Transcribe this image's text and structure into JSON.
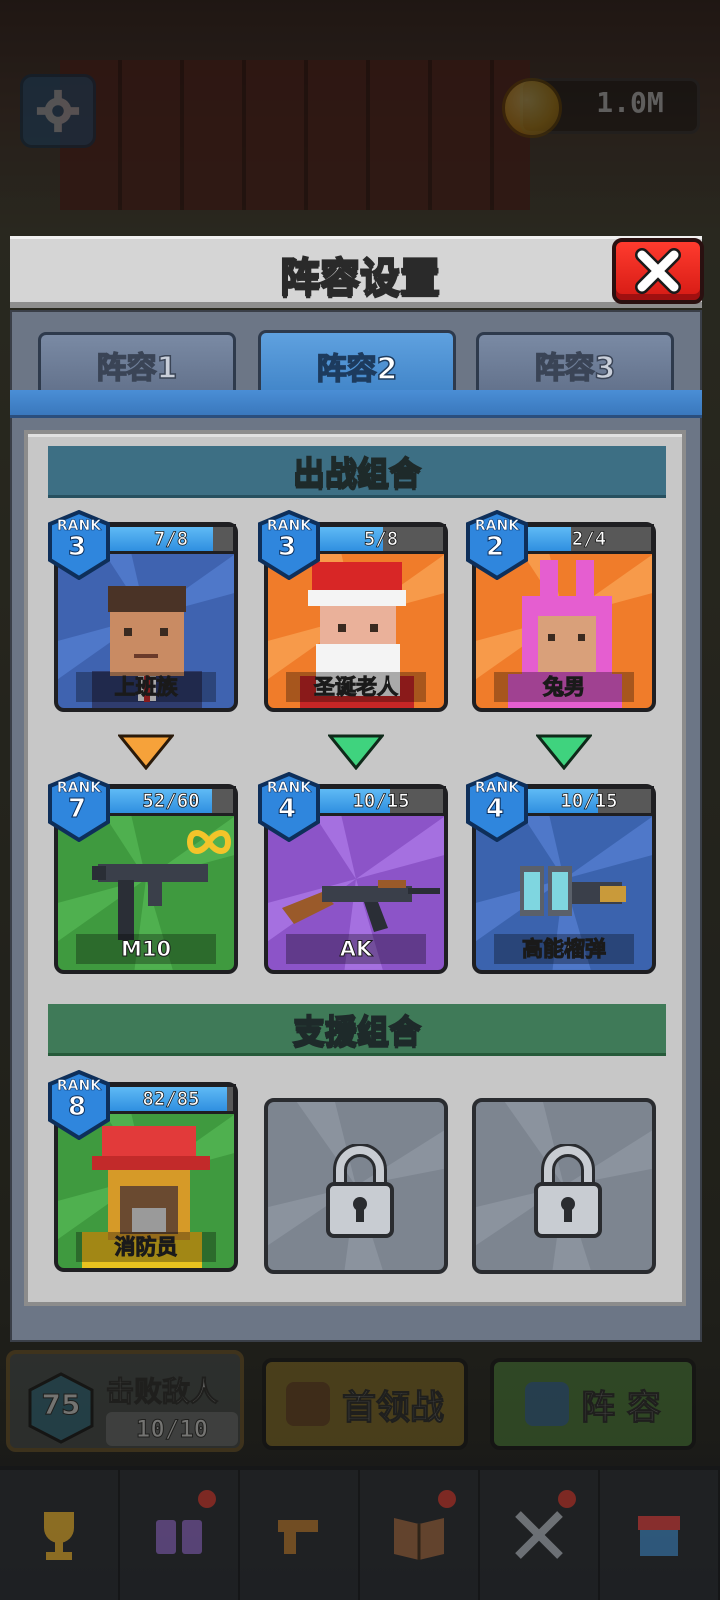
{
  "topbar": {
    "coins": "1.0M"
  },
  "modal": {
    "title": "阵容设置",
    "tabs": [
      {
        "label": "阵容1",
        "active": false
      },
      {
        "label": "阵容2",
        "active": true
      },
      {
        "label": "阵容3",
        "active": false
      }
    ]
  },
  "battle": {
    "title": "出战组合",
    "rank_word": "RANK",
    "heroes": [
      {
        "name": "上班族",
        "rank": "3",
        "progress": "7/8",
        "progress_fraction": 0.875
      },
      {
        "name": "圣诞老人",
        "rank": "3",
        "progress": "5/8",
        "progress_fraction": 0.625
      },
      {
        "name": "兔男",
        "rank": "2",
        "progress": "2/4",
        "progress_fraction": 0.5
      }
    ],
    "weapons": [
      {
        "name": "M10",
        "rank": "7",
        "progress": "52/60",
        "progress_fraction": 0.867,
        "infinite": true
      },
      {
        "name": "AK",
        "rank": "4",
        "progress": "10/15",
        "progress_fraction": 0.667
      },
      {
        "name": "高能榴弹",
        "rank": "4",
        "progress": "10/15",
        "progress_fraction": 0.667
      }
    ]
  },
  "support": {
    "title": "支援组合",
    "hero": {
      "name": "消防员",
      "rank": "8",
      "progress": "82/85",
      "progress_fraction": 0.965
    }
  },
  "hud": {
    "level": "75",
    "defeat_label": "击败敌人",
    "defeat_count": "10/10",
    "boss_label": "首领战",
    "lineup_label": "阵 容"
  },
  "colors": {
    "close": "#e5221a",
    "tab_active": "#4a8ed6",
    "battle_bar": "#3d6f84",
    "support_bar": "#3f7a58"
  }
}
